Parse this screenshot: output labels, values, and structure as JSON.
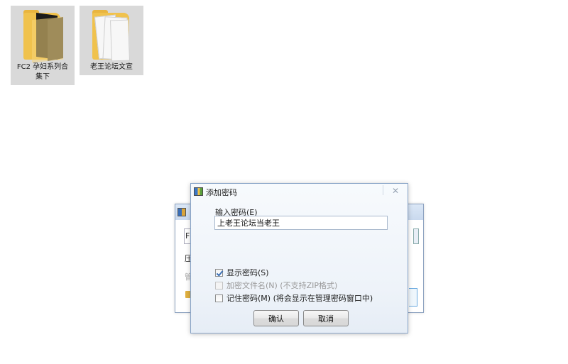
{
  "desktop": {
    "folders": [
      {
        "label": "FC2 孕妇系列合集下"
      },
      {
        "label": "老王论坛文宣"
      }
    ]
  },
  "background_dialog": {
    "fragments": [
      "F",
      "压",
      "管"
    ]
  },
  "dialog": {
    "title": "添加密码",
    "close_glyph": "✕",
    "password_label": "输入密码(E)",
    "password_value": "上老王论坛当老王",
    "checkboxes": [
      {
        "label": "显示密码(S)",
        "checked": true,
        "disabled": false
      },
      {
        "label": "加密文件名(N) (不支持ZIP格式)",
        "checked": false,
        "disabled": true
      },
      {
        "label": "记住密码(M) (将会显示在管理密码窗口中)",
        "checked": false,
        "disabled": false
      }
    ],
    "ok_label": "确认",
    "cancel_label": "取消"
  },
  "colors": {
    "dialog_border": "#8aa5c8",
    "checkmark": "#3b6fb4",
    "folder_yellow": "#f0c24d"
  }
}
